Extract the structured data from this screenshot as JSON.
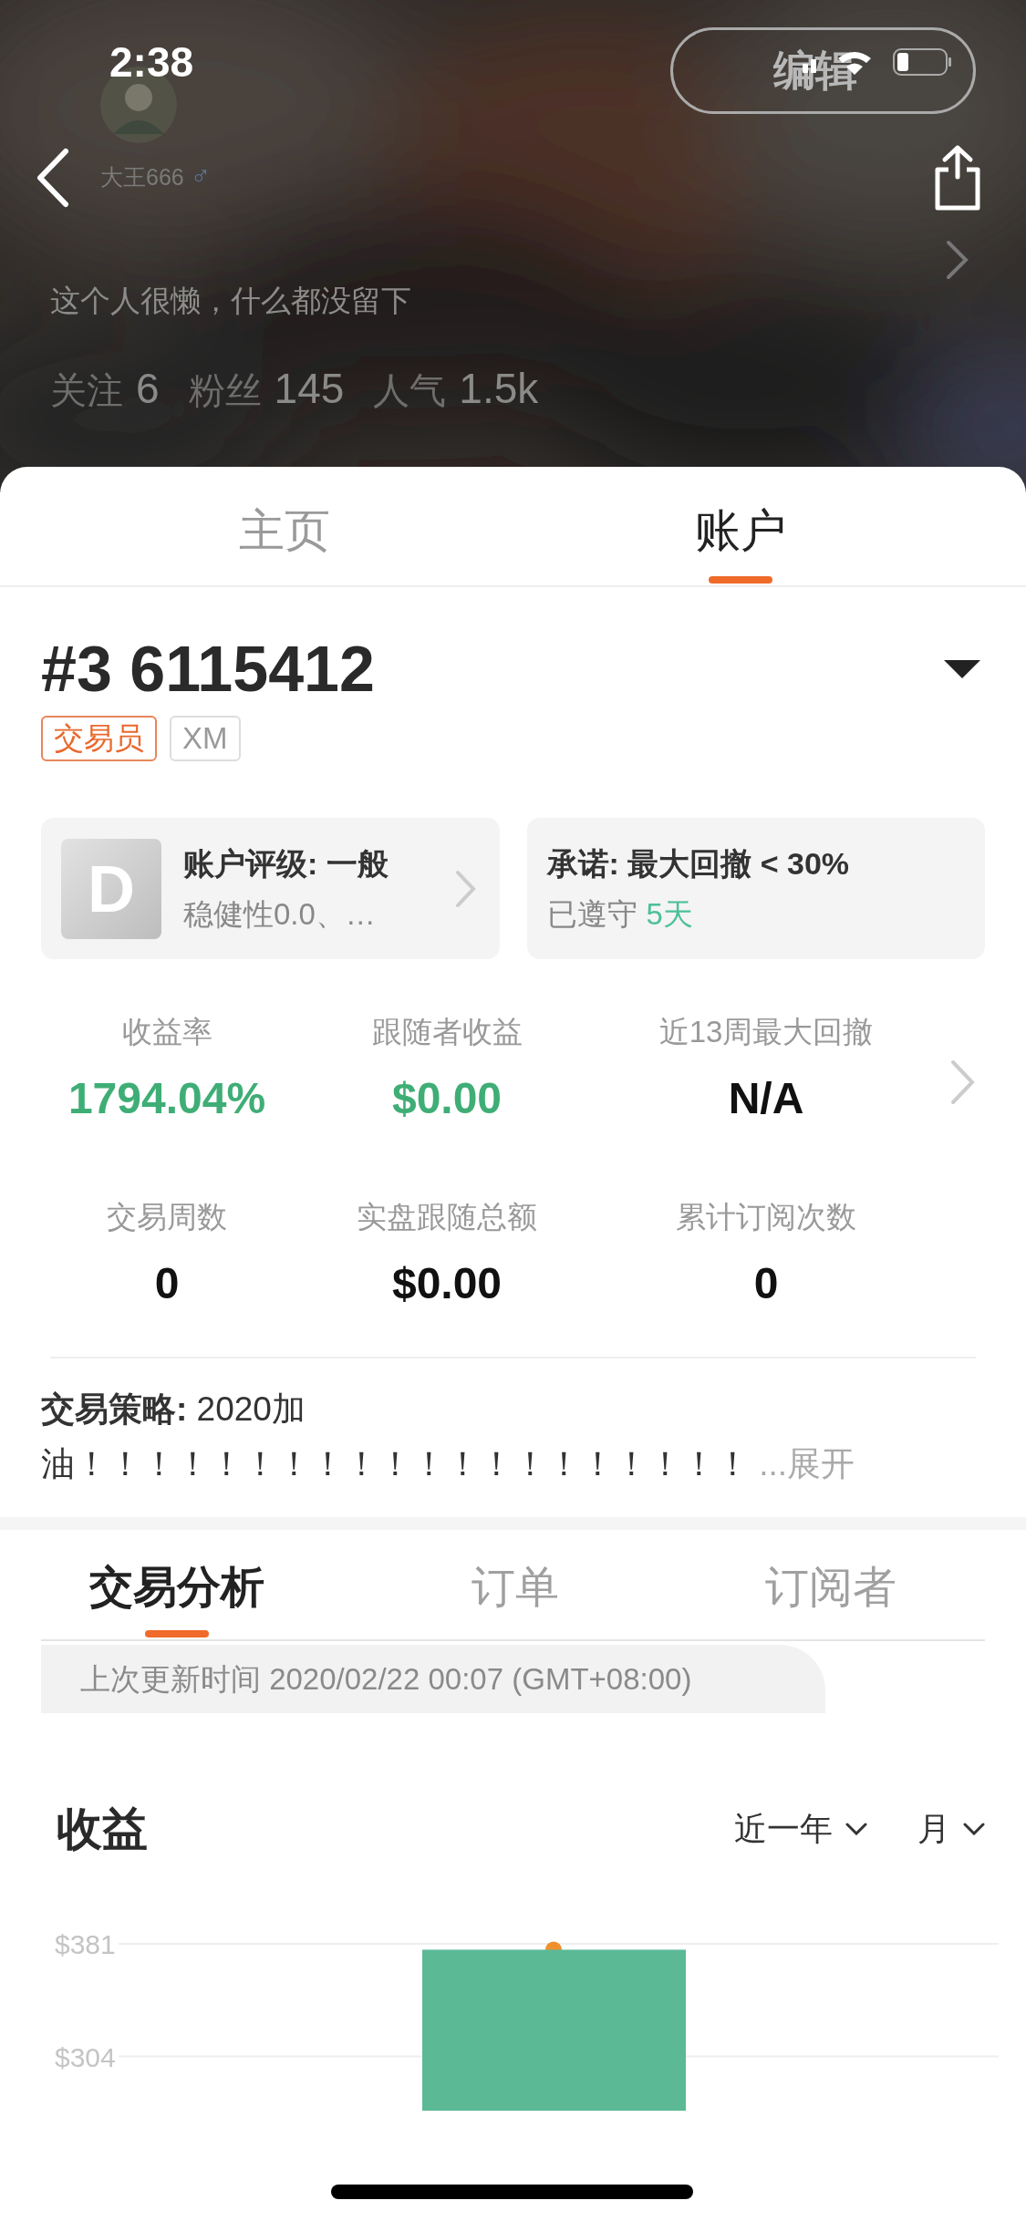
{
  "status_bar": {
    "time": "2:38"
  },
  "profile": {
    "edit_button": "编辑",
    "name": "大王666",
    "gender": "♂",
    "bio": "这个人很懒，什么都没留下",
    "stats": [
      {
        "label": "关注",
        "value": "6"
      },
      {
        "label": "粉丝",
        "value": "145"
      },
      {
        "label": "人气",
        "value": "1.5k"
      }
    ]
  },
  "tabs": [
    {
      "label": "主页",
      "selected": false
    },
    {
      "label": "账户",
      "selected": true
    }
  ],
  "account": {
    "title": "#3 6115412",
    "tags": [
      {
        "label": "交易员",
        "kind": "role"
      },
      {
        "label": "XM",
        "kind": "broker"
      }
    ],
    "rating_card": {
      "grade": "D",
      "title": "账户评级: 一般",
      "subtitle": "稳健性0.0、…"
    },
    "promise_card": {
      "title": "承诺: 最大回撤 < 30%",
      "status": "已遵守",
      "days": "5天"
    },
    "metrics": [
      {
        "label": "收益率",
        "value": "1794.04%",
        "kind": "positive"
      },
      {
        "label": "跟随者收益",
        "value": "$0.00",
        "kind": "positive"
      },
      {
        "label": "近13周最大回撤",
        "value": "N/A",
        "kind": "neutral"
      },
      {
        "label": "交易周数",
        "value": "0",
        "kind": "neutral"
      },
      {
        "label": "实盘跟随总额",
        "value": "$0.00",
        "kind": "neutral"
      },
      {
        "label": "累计订阅次数",
        "value": "0",
        "kind": "neutral"
      }
    ],
    "strategy": {
      "text": "**交易策略:** 2020加油！！！！！！！！！！！！！！！！！！！！",
      "expand": "...展开"
    }
  },
  "analysis_tabs": [
    {
      "label": "交易分析",
      "selected": true
    },
    {
      "label": "订单",
      "selected": false
    },
    {
      "label": "订阅者",
      "selected": false
    }
  ],
  "update_time": "上次更新时间 2020/02/22 00:07 (GMT+08:00)",
  "profit": {
    "title": "收益",
    "filters": [
      {
        "label": "近一年"
      },
      {
        "label": "月"
      }
    ],
    "chart_data": {
      "type": "bar",
      "ylim": [
        267,
        381
      ],
      "yticks": [
        {
          "value": 381,
          "label": "$381"
        },
        {
          "value": 304,
          "label": "$304"
        }
      ],
      "series": [
        {
          "color": "#5bb996",
          "values": [
            377
          ]
        }
      ]
    }
  }
}
